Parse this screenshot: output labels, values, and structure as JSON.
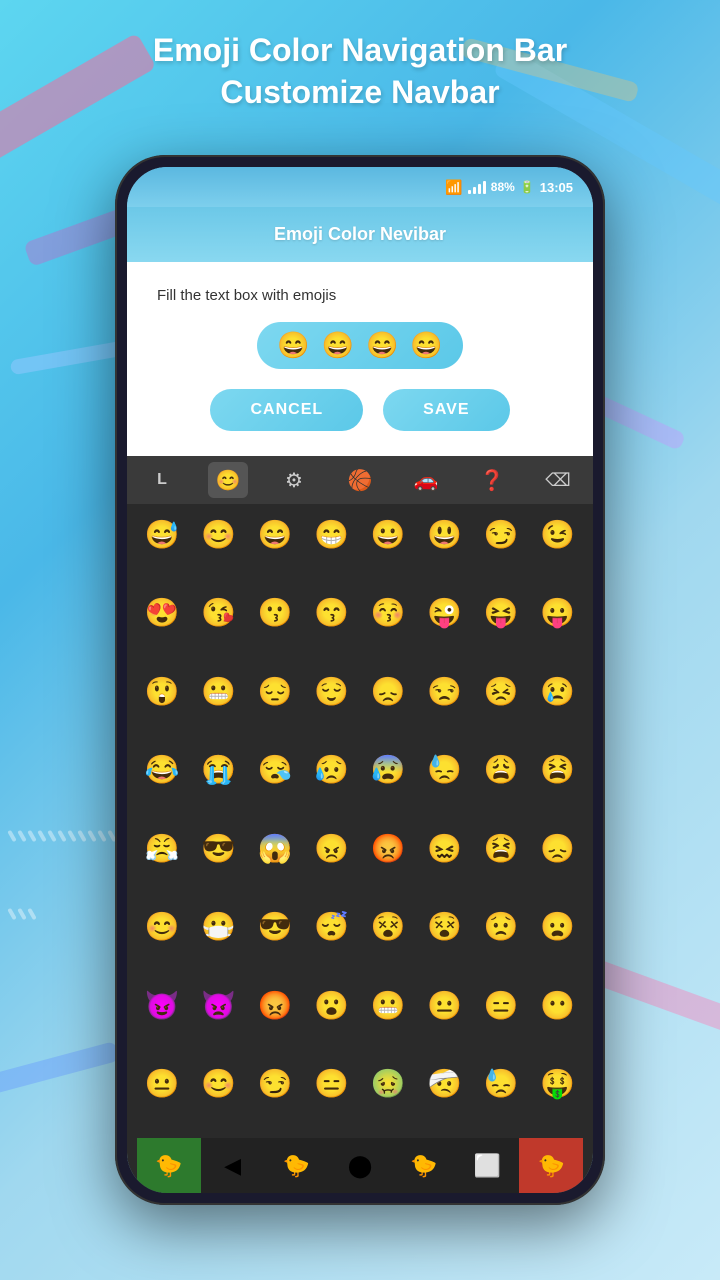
{
  "background": {
    "color_start": "#5dd6f0",
    "color_end": "#c8eaf8"
  },
  "page_title_line1": "Emoji Color Navigation Bar",
  "page_title_line2": "Customize Navbar",
  "status_bar": {
    "battery": "88%",
    "time": "13:05"
  },
  "app_header": {
    "title": "Emoji Color Nevibar"
  },
  "dialog": {
    "prompt": "Fill the text box with emojis",
    "emoji_slots": [
      "😄",
      "😄",
      "😄",
      "😄"
    ],
    "cancel_label": "CANCEL",
    "save_label": "SAVE"
  },
  "keyboard": {
    "tabs": [
      {
        "label": "L",
        "type": "letter"
      },
      {
        "label": "😊",
        "type": "smiley"
      },
      {
        "label": "⚙",
        "type": "settings"
      },
      {
        "label": "🏀",
        "type": "sports"
      },
      {
        "label": "🚗",
        "type": "transport"
      },
      {
        "label": "❓",
        "type": "misc"
      },
      {
        "label": "⌫",
        "type": "backspace"
      }
    ]
  },
  "emojis": [
    "😅",
    "😊",
    "😄",
    "😁",
    "😀",
    "😃",
    "😏",
    "😉",
    "😍",
    "😘",
    "😗",
    "😙",
    "😚",
    "😜",
    "😝",
    "😛",
    "😲",
    "😬",
    "😔",
    "😌",
    "😞",
    "😒",
    "😣",
    "😢",
    "😂",
    "😭",
    "😪",
    "😥",
    "😰",
    "😓",
    "😩",
    "😫",
    "😤",
    "😎",
    "😱",
    "😠",
    "😡",
    "😖",
    "😫",
    "😞",
    "😊",
    "😷",
    "😎",
    "😴",
    "😵",
    "😵",
    "😟",
    "😦",
    "😈",
    "👿",
    "😡",
    "😮",
    "😬",
    "😐",
    "😑",
    "😶",
    "😐",
    "😊",
    "😏",
    "😑",
    "🤢",
    "🤕",
    "😓",
    "🤑"
  ],
  "nav_bar": {
    "segments": [
      {
        "icon": "🐤",
        "bg": "green"
      },
      {
        "icon": "◀",
        "bg": "dark"
      },
      {
        "icon": "🐤",
        "bg": "dark"
      },
      {
        "icon": "⬤",
        "bg": "dark"
      },
      {
        "icon": "🐤",
        "bg": "dark"
      },
      {
        "icon": "⬜",
        "bg": "dark"
      },
      {
        "icon": "🐤",
        "bg": "red"
      }
    ]
  }
}
